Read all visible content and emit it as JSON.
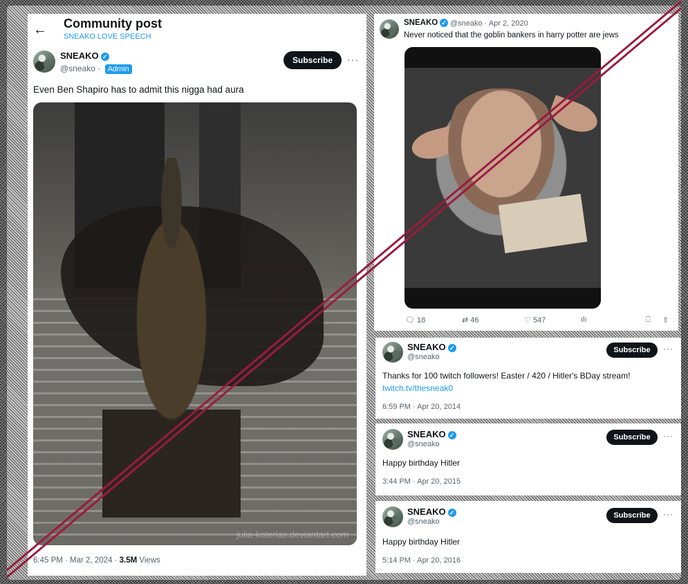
{
  "left_post": {
    "title": "Community post",
    "subtitle": "SNEAKO LOVE SPEECH",
    "author_name": "SNEAKO",
    "author_handle": "@sneako",
    "handle_sep": " · ",
    "admin_label": "Admin",
    "subscribe_label": "Subscribe",
    "more": "···",
    "text": "Even Ben Shapiro has to admit this nigga had aura",
    "watermark": "julia-koterias.deviantart.com",
    "time": "6:45 PM · Mar 2, 2024 · ",
    "views_count": "3.5M",
    "views_label": " Views"
  },
  "top_right_post": {
    "author_name": "SNEAKO",
    "handle_date": "@sneako · Apr 2, 2020",
    "more": "···",
    "text": "Never noticed that the goblin bankers in harry potter are jews",
    "replies": "18",
    "retweets": "46",
    "likes": "547",
    "icons": [
      "reply-icon",
      "retweet-icon",
      "like-icon",
      "views-icon",
      "bookmark-icon",
      "share-icon"
    ]
  },
  "posts": [
    {
      "author_name": "SNEAKO",
      "author_handle": "@sneako",
      "subscribe_label": "Subscribe",
      "more": "···",
      "text": "Thanks for 100 twitch followers! Easter / 420 / Hitler's BDay stream!",
      "link": "twitch.tv/thesneak0",
      "time": "6:59 PM · Apr 20, 2014"
    },
    {
      "author_name": "SNEAKO",
      "author_handle": "@sneako",
      "subscribe_label": "Subscribe",
      "more": "···",
      "text": "Happy birthday Hitler",
      "time": "3:44 PM · Apr 20, 2015"
    },
    {
      "author_name": "SNEAKO",
      "author_handle": "@sneako",
      "subscribe_label": "Subscribe",
      "more": "···",
      "text": "Happy birthday Hitler",
      "time": "5:14 PM · Apr 20, 2016"
    }
  ],
  "colors": {
    "accent": "#1d9bf0",
    "strike": "#9b1b3f",
    "button": "#0f1419"
  }
}
